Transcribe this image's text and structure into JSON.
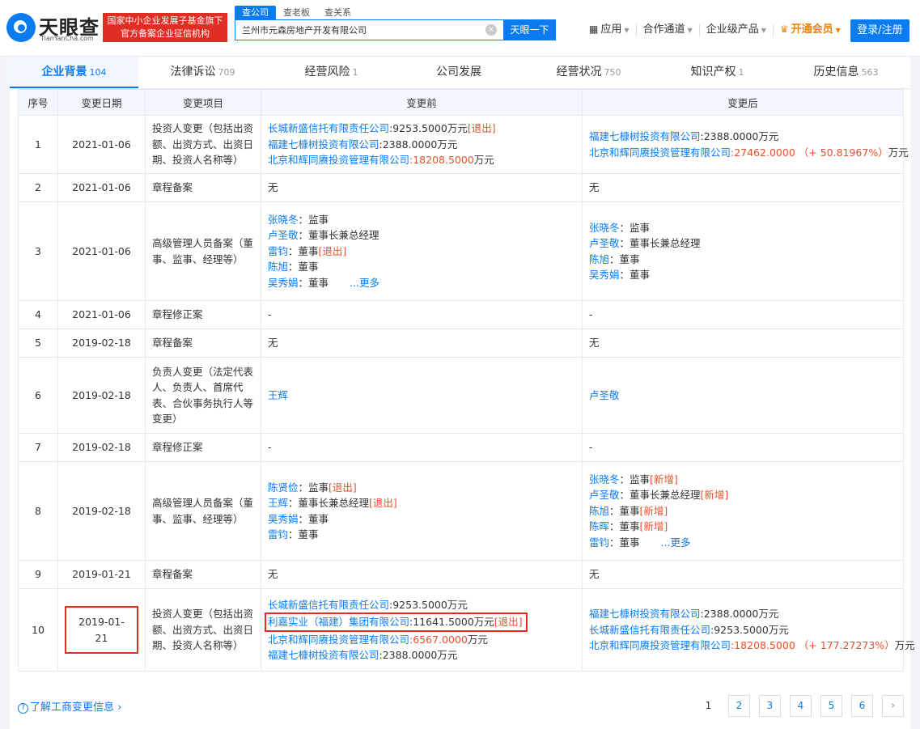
{
  "header": {
    "logo_cn": "天眼查",
    "logo_en": "TianYanCha.com",
    "slogan_line1": "国家中小企业发展子基金旗下",
    "slogan_line2": "官方备案企业征信机构",
    "search_tabs": [
      "查公司",
      "查老板",
      "查关系"
    ],
    "search_value": "兰州市元森房地产开发有限公司",
    "search_button": "天眼一下",
    "nav": [
      "应用",
      "合作通道",
      "企业级产品",
      "开通会员"
    ],
    "login": "登录/注册"
  },
  "tabs": [
    {
      "label": "企业背景",
      "count": "104"
    },
    {
      "label": "法律诉讼",
      "count": "709"
    },
    {
      "label": "经营风险",
      "count": "1"
    },
    {
      "label": "公司发展",
      "count": ""
    },
    {
      "label": "经营状况",
      "count": "750"
    },
    {
      "label": "知识产权",
      "count": "1"
    },
    {
      "label": "历史信息",
      "count": "563"
    }
  ],
  "table": {
    "headers": [
      "序号",
      "变更日期",
      "变更项目",
      "变更前",
      "变更后"
    ],
    "rows": [
      {
        "idx": "1",
        "date": "2021-01-06",
        "item": "投资人变更（包括出资额、出资方式、出资日期、投资人名称等）",
        "before": [
          {
            "name": "长城新盛信托有限责任公司",
            "text": ":9253.5000万元",
            "tag": "[退出]"
          },
          {
            "name": "福建七槺树投资有限公司",
            "text": ":2388.0000万元"
          },
          {
            "name": "北京和辉同赓投资管理有限公司",
            "redtext": ":18208.5000",
            "text": "万元"
          }
        ],
        "after": [
          {
            "name": "福建七槺树投资有限公司",
            "text": ":2388.0000万元"
          },
          {
            "name": "北京和辉同赓投资管理有限公司",
            "redtext": ":27462.0000 （+ 50.81967%）",
            "text": "万元"
          }
        ]
      },
      {
        "idx": "2",
        "date": "2021-01-06",
        "item": "章程备案",
        "before_text": "无",
        "after_text": "无"
      },
      {
        "idx": "3",
        "date": "2021-01-06",
        "item": "高级管理人员备案（董事、监事、经理等）",
        "before": [
          {
            "name": "张晓冬",
            "text": "：监事"
          },
          {
            "name": "卢圣敬",
            "text": "：董事长兼总经理"
          },
          {
            "name": "雷钧",
            "text": "：董事",
            "tag": "[退出]"
          },
          {
            "name": "陈旭",
            "text": "：董事"
          },
          {
            "name": "吴秀娟",
            "text": "：董事",
            "more": "...更多"
          }
        ],
        "after": [
          {
            "name": "张晓冬",
            "text": "：监事"
          },
          {
            "name": "卢圣敬",
            "text": "：董事长兼总经理"
          },
          {
            "name": "陈旭",
            "text": "：董事"
          },
          {
            "name": "吴秀娟",
            "text": "：董事"
          }
        ]
      },
      {
        "idx": "4",
        "date": "2021-01-06",
        "item": "章程修正案",
        "before_text": "-",
        "after_text": "-"
      },
      {
        "idx": "5",
        "date": "2019-02-18",
        "item": "章程备案",
        "before_text": "无",
        "after_text": "无"
      },
      {
        "idx": "6",
        "date": "2019-02-18",
        "item": "负责人变更（法定代表人、负责人、首席代表、合伙事务执行人等变更）",
        "before": [
          {
            "name": "王辉"
          }
        ],
        "after": [
          {
            "name": "卢圣敬"
          }
        ]
      },
      {
        "idx": "7",
        "date": "2019-02-18",
        "item": "章程修正案",
        "before_text": "-",
        "after_text": "-"
      },
      {
        "idx": "8",
        "date": "2019-02-18",
        "item": "高级管理人员备案（董事、监事、经理等）",
        "before": [
          {
            "name": "陈贤俭",
            "text": "：监事",
            "tag": "[退出]"
          },
          {
            "name": "王辉",
            "text": "：董事长兼总经理",
            "tag": "[退出]"
          },
          {
            "name": "吴秀娟",
            "text": "：董事"
          },
          {
            "name": "雷钧",
            "text": "：董事"
          }
        ],
        "after": [
          {
            "name": "张晓冬",
            "text": "：监事",
            "tag": "[新增]"
          },
          {
            "name": "卢圣敬",
            "text": "：董事长兼总经理",
            "tag": "[新增]"
          },
          {
            "name": "陈旭",
            "text": "：董事",
            "tag": "[新增]"
          },
          {
            "name": "陈晖",
            "text": "：董事",
            "tag": "[新增]"
          },
          {
            "name": "雷钧",
            "text": "：董事",
            "more": "...更多"
          }
        ]
      },
      {
        "idx": "9",
        "date": "2019-01-21",
        "item": "章程备案",
        "before_text": "无",
        "after_text": "无"
      },
      {
        "idx": "10",
        "date": "2019-01-21",
        "item": "投资人变更（包括出资额、出资方式、出资日期、投资人名称等）",
        "before": [
          {
            "name": "长城新盛信托有限责任公司",
            "text": ":9253.5000万元"
          },
          {
            "name": "利嘉实业（福建）集团有限公司",
            "text": ":11641.5000万元",
            "tag": "[退出]"
          },
          {
            "name": "北京和辉同赓投资管理有限公司",
            "redtext": ":6567.0000",
            "text": "万元"
          },
          {
            "name": "福建七槺树投资有限公司",
            "text": ":2388.0000万元"
          }
        ],
        "after": [
          {
            "name": "福建七槺树投资有限公司",
            "text": ":2388.0000万元"
          },
          {
            "name": "长城新盛信托有限责任公司",
            "text": ":9253.5000万元"
          },
          {
            "name": "北京和辉同赓投资管理有限公司",
            "redtext": ":18208.5000 （+ 177.27273%）",
            "text": "万元"
          }
        ]
      }
    ]
  },
  "footer": {
    "learn_link": "了解工商变更信息",
    "pages": [
      "1",
      "2",
      "3",
      "4",
      "5",
      "6"
    ],
    "next": "›"
  }
}
